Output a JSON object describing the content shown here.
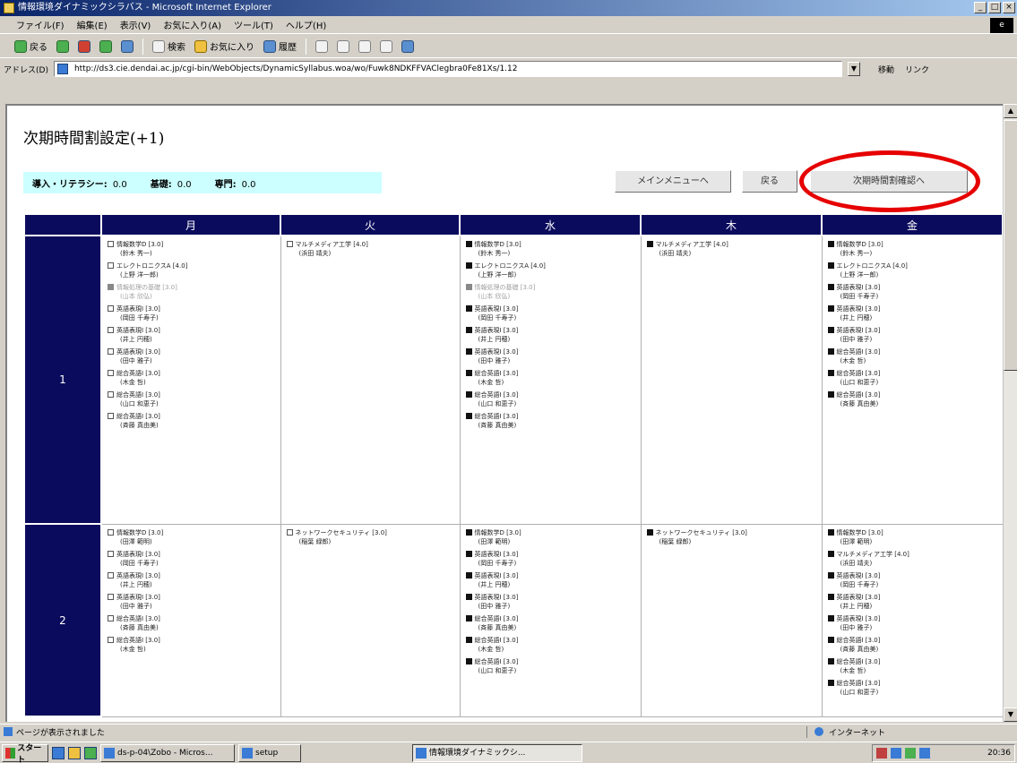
{
  "window": {
    "title": "情報環境ダイナミックシラバス - Microsoft Internet Explorer",
    "min": "_",
    "max": "□",
    "close": "×"
  },
  "menu": [
    "ファイル(F)",
    "編集(E)",
    "表示(V)",
    "お気に入り(A)",
    "ツール(T)",
    "ヘルプ(H)"
  ],
  "toolbar": {
    "back": "戻る",
    "search": "検索",
    "favorites": "お気に入り",
    "history": "履歴"
  },
  "address": {
    "label": "アドレス(D)",
    "url": "http://ds3.cie.dendai.ac.jp/cgi-bin/WebObjects/DynamicSyllabus.woa/wo/Fuwk8NDKFFVAClegbra0Fe81Xs/1.12",
    "go": "移動",
    "links": "リンク"
  },
  "page": {
    "title": "次期時間割設定(+1)",
    "stats": {
      "intro_label": "導入・リテラシー:",
      "intro_value": "0.0",
      "basic_label": "基礎:",
      "basic_value": "0.0",
      "major_label": "専門:",
      "major_value": "0.0"
    },
    "buttons": {
      "main_menu": "メインメニューへ",
      "back": "戻る",
      "next_confirm": "次期時間割確認へ"
    }
  },
  "timetable": {
    "days": [
      "月",
      "火",
      "水",
      "木",
      "金"
    ],
    "periods": [
      {
        "label": "1",
        "cells": [
          [
            {
              "mark": "chk",
              "name": "情報数学D [3.0]",
              "teacher": "(鈴木 秀一)"
            },
            {
              "mark": "chk",
              "name": "エレクトロニクスA [4.0]",
              "teacher": "(上野 洋一郎)"
            },
            {
              "mark": "grey",
              "name": "情報処理の基礎 [3.0]",
              "teacher": "(山本 欣弘)",
              "dim": true
            },
            {
              "mark": "chk",
              "name": "英語表現I [3.0]",
              "teacher": "(岡田 千寿子)"
            },
            {
              "mark": "chk",
              "name": "英語表現I [3.0]",
              "teacher": "(井上 円穂)"
            },
            {
              "mark": "chk",
              "name": "英語表現I [3.0]",
              "teacher": "(田中 雅子)"
            },
            {
              "mark": "chk",
              "name": "総合英語I [3.0]",
              "teacher": "(木金 哲)"
            },
            {
              "mark": "chk",
              "name": "総合英語I [3.0]",
              "teacher": "(山口 和恵子)"
            },
            {
              "mark": "chk",
              "name": "総合英語I [3.0]",
              "teacher": "(斉藤 真由美)"
            }
          ],
          [
            {
              "mark": "chk",
              "name": "マルチメディア工学 [4.0]",
              "teacher": "(浜田 靖夫)"
            }
          ],
          [
            {
              "mark": "fill",
              "name": "情報数学D [3.0]",
              "teacher": "(鈴木 秀一)"
            },
            {
              "mark": "fill",
              "name": "エレクトロニクスA [4.0]",
              "teacher": "(上野 洋一郎)"
            },
            {
              "mark": "grey",
              "name": "情報処理の基礎 [3.0]",
              "teacher": "(山本 欣弘)",
              "dim": true
            },
            {
              "mark": "fill",
              "name": "英語表現I [3.0]",
              "teacher": "(岡田 千寿子)"
            },
            {
              "mark": "fill",
              "name": "英語表現I [3.0]",
              "teacher": "(井上 円穂)"
            },
            {
              "mark": "fill",
              "name": "英語表現I [3.0]",
              "teacher": "(田中 雅子)"
            },
            {
              "mark": "fill",
              "name": "総合英語I [3.0]",
              "teacher": "(木金 哲)"
            },
            {
              "mark": "fill",
              "name": "総合英語I [3.0]",
              "teacher": "(山口 和恵子)"
            },
            {
              "mark": "fill",
              "name": "総合英語I [3.0]",
              "teacher": "(斉藤 真由美)"
            }
          ],
          [
            {
              "mark": "fill",
              "name": "マルチメディア工学 [4.0]",
              "teacher": "(浜田 靖夫)"
            }
          ],
          [
            {
              "mark": "fill",
              "name": "情報数学D [3.0]",
              "teacher": "(鈴木 秀一)"
            },
            {
              "mark": "fill",
              "name": "エレクトロニクスA [4.0]",
              "teacher": "(上野 洋一郎)"
            },
            {
              "mark": "fill",
              "name": "英語表現I [3.0]",
              "teacher": "(岡田 千寿子)"
            },
            {
              "mark": "fill",
              "name": "英語表現I [3.0]",
              "teacher": "(井上 円穂)"
            },
            {
              "mark": "fill",
              "name": "英語表現I [3.0]",
              "teacher": "(田中 雅子)"
            },
            {
              "mark": "fill",
              "name": "総合英語I [3.0]",
              "teacher": "(木金 哲)"
            },
            {
              "mark": "fill",
              "name": "総合英語I [3.0]",
              "teacher": "(山口 和恵子)"
            },
            {
              "mark": "fill",
              "name": "総合英語I [3.0]",
              "teacher": "(斉藤 真由美)"
            }
          ]
        ]
      },
      {
        "label": "2",
        "cells": [
          [
            {
              "mark": "chk",
              "name": "情報数学D [3.0]",
              "teacher": "(田澤 範明)"
            },
            {
              "mark": "chk",
              "name": "英語表現I [3.0]",
              "teacher": "(岡田 千寿子)"
            },
            {
              "mark": "chk",
              "name": "英語表現I [3.0]",
              "teacher": "(井上 円穂)"
            },
            {
              "mark": "chk",
              "name": "英語表現I [3.0]",
              "teacher": "(田中 雅子)"
            },
            {
              "mark": "chk",
              "name": "総合英語I [3.0]",
              "teacher": "(斉藤 真由美)"
            },
            {
              "mark": "chk",
              "name": "総合英語I [3.0]",
              "teacher": "(木金 哲)"
            }
          ],
          [
            {
              "mark": "chk",
              "name": "ネットワークセキュリティ [3.0]",
              "teacher": "(稲葉 緑郎)"
            }
          ],
          [
            {
              "mark": "fill",
              "name": "情報数学D [3.0]",
              "teacher": "(田澤 範明)"
            },
            {
              "mark": "fill",
              "name": "英語表現I [3.0]",
              "teacher": "(岡田 千寿子)"
            },
            {
              "mark": "fill",
              "name": "英語表現I [3.0]",
              "teacher": "(井上 円穂)"
            },
            {
              "mark": "fill",
              "name": "英語表現I [3.0]",
              "teacher": "(田中 雅子)"
            },
            {
              "mark": "fill",
              "name": "総合英語I [3.0]",
              "teacher": "(斉藤 真由美)"
            },
            {
              "mark": "fill",
              "name": "総合英語I [3.0]",
              "teacher": "(木金 哲)"
            },
            {
              "mark": "fill",
              "name": "総合英語I [3.0]",
              "teacher": "(山口 和恵子)"
            }
          ],
          [
            {
              "mark": "fill",
              "name": "ネットワークセキュリティ [3.0]",
              "teacher": "(稲葉 緑郎)"
            }
          ],
          [
            {
              "mark": "fill",
              "name": "情報数学D [3.0]",
              "teacher": "(田澤 範明)"
            },
            {
              "mark": "fill",
              "name": "マルチメディア工学 [4.0]",
              "teacher": "(浜田 靖夫)"
            },
            {
              "mark": "fill",
              "name": "英語表現I [3.0]",
              "teacher": "(岡田 千寿子)"
            },
            {
              "mark": "fill",
              "name": "英語表現I [3.0]",
              "teacher": "(井上 円穂)"
            },
            {
              "mark": "fill",
              "name": "英語表現I [3.0]",
              "teacher": "(田中 雅子)"
            },
            {
              "mark": "fill",
              "name": "総合英語I [3.0]",
              "teacher": "(斉藤 真由美)"
            },
            {
              "mark": "fill",
              "name": "総合英語I [3.0]",
              "teacher": "(木金 哲)"
            },
            {
              "mark": "fill",
              "name": "総合英語I [3.0]",
              "teacher": "(山口 和恵子)"
            }
          ]
        ]
      }
    ]
  },
  "status": {
    "message": "ページが表示されました",
    "zone": "インターネット"
  },
  "taskbar": {
    "start": "スタート",
    "tasks": [
      "ds-p-04\\Zobo - Micros...",
      "setup",
      "情報環境ダイナミックシ..."
    ],
    "clock": "20:36"
  }
}
